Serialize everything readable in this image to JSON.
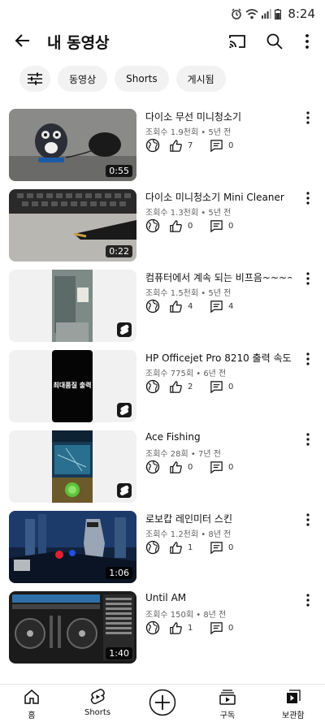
{
  "status_bar": {
    "time": "8:24"
  },
  "header": {
    "title": "내 동영상"
  },
  "chips": [
    "동영상",
    "Shorts",
    "게시됨"
  ],
  "videos": [
    {
      "title": "다이소 무선 미니청소기",
      "meta": "조회수 1.9천회 • 5년 전",
      "likes": "7",
      "comments": "0",
      "duration": "0:55",
      "type": "video"
    },
    {
      "title": "다이소 미니청소기 Mini Cleaner",
      "meta": "조회수 1.3천회 • 5년 전",
      "likes": "0",
      "comments": "0",
      "duration": "0:22",
      "type": "video"
    },
    {
      "title": "컴퓨터에서 계속 되는 비프음~~~~",
      "meta": "조회수 1.5천회 • 5년 전",
      "likes": "4",
      "comments": "4",
      "duration": "",
      "type": "short"
    },
    {
      "title": "HP Officejet Pro 8210 출력 속도",
      "meta": "조회수 775회 • 6년 전",
      "likes": "2",
      "comments": "0",
      "duration": "",
      "type": "short",
      "thumb_text": "최대품질 출력"
    },
    {
      "title": "Ace Fishing",
      "meta": "조회수 28회 • 7년 전",
      "likes": "0",
      "comments": "0",
      "duration": "",
      "type": "short"
    },
    {
      "title": "로보캅 레인미터 스킨",
      "meta": "조회수 1.2천회 • 8년 전",
      "likes": "1",
      "comments": "0",
      "duration": "1:06",
      "type": "video"
    },
    {
      "title": "Until AM",
      "meta": "조회수 150회 • 8년 전",
      "likes": "1",
      "comments": "0",
      "duration": "1:40",
      "type": "video"
    }
  ],
  "nav": {
    "home": "홈",
    "shorts": "Shorts",
    "subscriptions": "구독",
    "library": "보관함"
  }
}
